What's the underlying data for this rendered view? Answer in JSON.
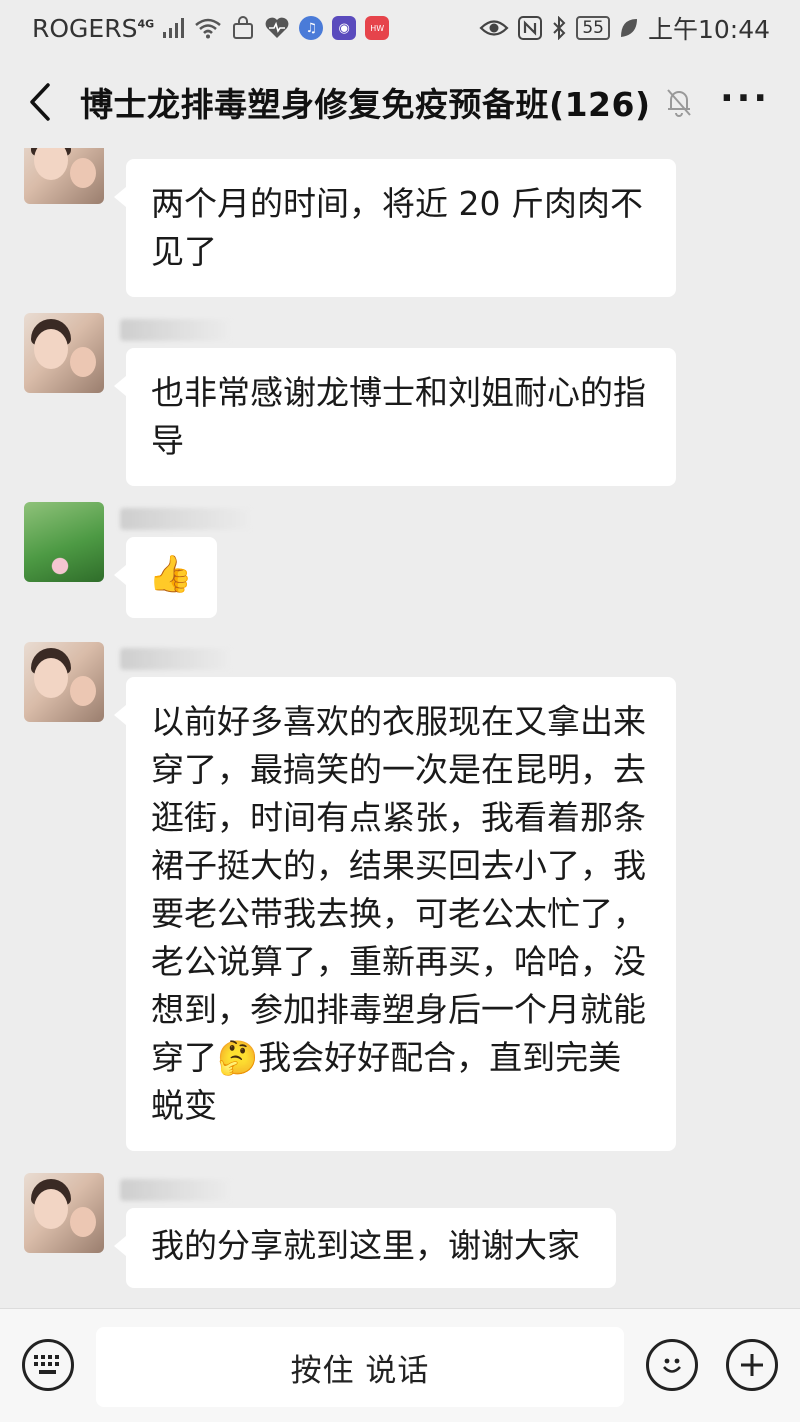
{
  "status_bar": {
    "carrier": "ROGERS",
    "network": "4G",
    "battery": "55",
    "time": "上午10:44"
  },
  "header": {
    "title": "博士龙排毒塑身修复免疫预备班(126)"
  },
  "messages": [
    {
      "text": "两个月的时间，将近 20 斤肉肉不见了"
    },
    {
      "text": "也非常感谢龙博士和刘姐耐心的指导"
    },
    {
      "text": "👍"
    },
    {
      "text": "以前好多喜欢的衣服现在又拿出来穿了，最搞笑的一次是在昆明，去逛街，时间有点紧张，我看着那条裙子挺大的，结果买回去小了，我要老公带我去换，可老公太忙了，老公说算了，重新再买，哈哈，没想到，参加排毒塑身后一个月就能穿了🤔我会好好配合，直到完美蜕变"
    },
    {
      "text": "我的分享就到这里，谢谢大家"
    }
  ],
  "input_bar": {
    "hold_to_talk": "按住 说话"
  }
}
